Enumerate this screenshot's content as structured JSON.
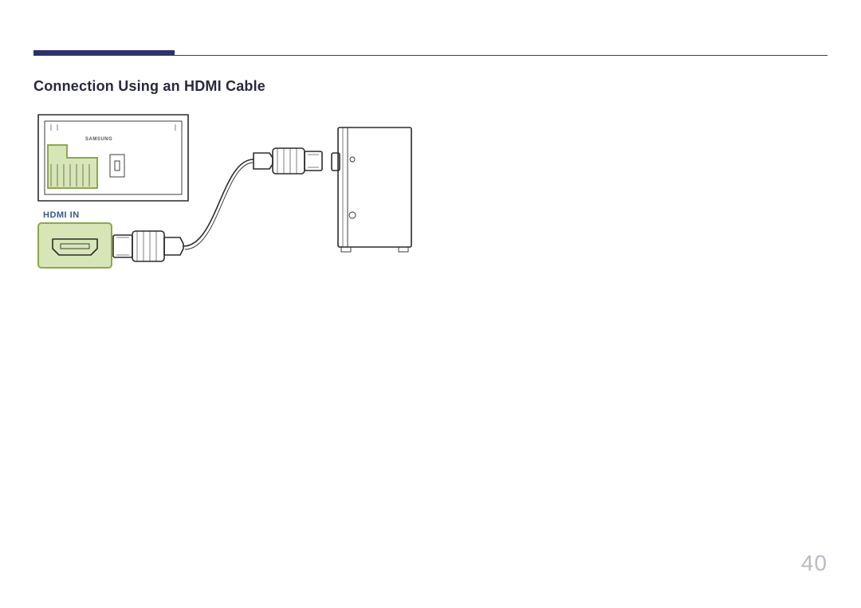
{
  "page": {
    "heading": "Connection Using an HDMI Cable",
    "port_label": "HDMI IN",
    "device_brand": "SAMSUNG",
    "page_number": "40"
  }
}
